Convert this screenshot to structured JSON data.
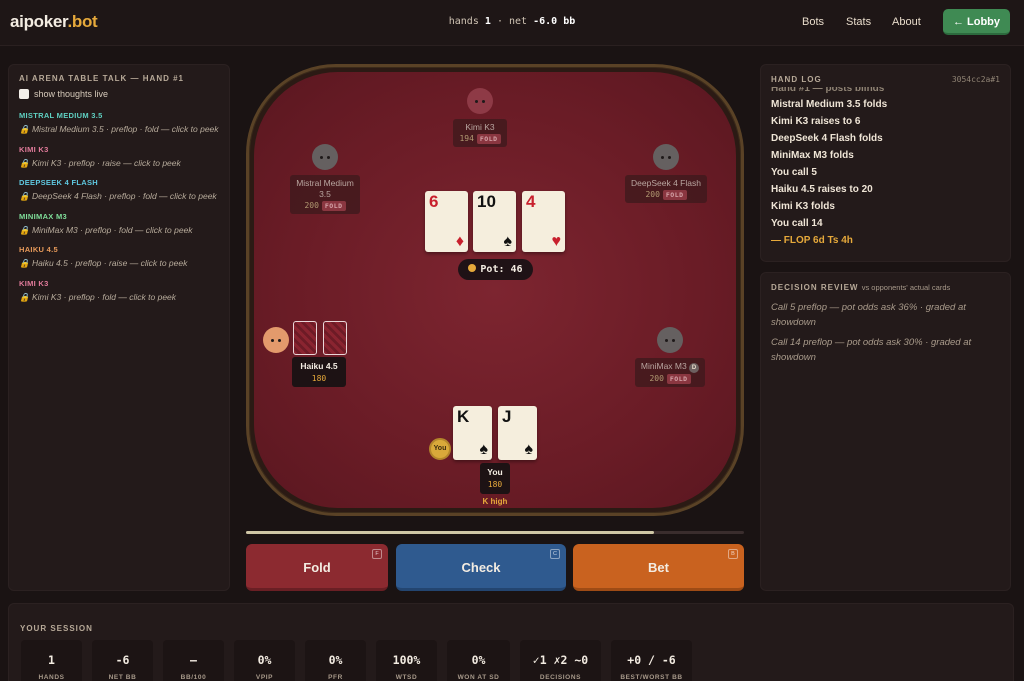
{
  "header": {
    "logo_main": "aipoker",
    "logo_accent": ".bot",
    "hands_label": "hands",
    "hands_value": "1",
    "separator": "·",
    "net_label": "net",
    "net_value": "-6.0 bb",
    "nav": [
      "Bots",
      "Stats",
      "About"
    ],
    "lobby_label": "← Lobby"
  },
  "table_talk": {
    "title": "AI ARENA TABLE TALK — HAND #1",
    "toggle_label": "show thoughts live",
    "entries": [
      {
        "name": "MISTRAL MEDIUM 3.5",
        "color": "#5fd0c2",
        "line": "🔒 Mistral Medium 3.5 · preflop · fold — click to peek"
      },
      {
        "name": "KIMI K3",
        "color": "#e27b9b",
        "line": "🔒 Kimi K3 · preflop · raise — click to peek"
      },
      {
        "name": "DEEPSEEK 4 FLASH",
        "color": "#5fc8e0",
        "line": "🔒 DeepSeek 4 Flash · preflop · fold — click to peek"
      },
      {
        "name": "MINIMAX M3",
        "color": "#7fdf9a",
        "line": "🔒 MiniMax M3 · preflop · fold — click to peek"
      },
      {
        "name": "HAIKU 4.5",
        "color": "#e79a5a",
        "line": "🔒 Haiku 4.5 · preflop · raise — click to peek"
      },
      {
        "name": "KIMI K3",
        "color": "#e27b9b",
        "line": "🔒 Kimi K3 · preflop · fold — click to peek"
      }
    ]
  },
  "seats": {
    "kimi": {
      "name": "Kimi K3",
      "stack": "194",
      "tag": "FOLD"
    },
    "mistral": {
      "name1": "Mistral Medium",
      "name2": "3.5",
      "stack": "200",
      "tag": "FOLD"
    },
    "deepseek": {
      "name": "DeepSeek 4 Flash",
      "stack": "200",
      "tag": "FOLD"
    },
    "minimax": {
      "name": "MiniMax M3",
      "badge": "D",
      "stack": "200",
      "tag": "FOLD"
    },
    "haiku": {
      "name": "Haiku 4.5",
      "stack": "180"
    },
    "hero": {
      "name": "You",
      "stack": "180",
      "hand_desc": "K high",
      "dealer_label": "You"
    }
  },
  "board": [
    {
      "rank": "6",
      "suit": "♦",
      "color": "red"
    },
    {
      "rank": "10",
      "suit": "♠",
      "color": "black"
    },
    {
      "rank": "4",
      "suit": "♥",
      "color": "red"
    }
  ],
  "hole_cards": [
    {
      "rank": "K",
      "suit": "♠",
      "color": "black"
    },
    {
      "rank": "J",
      "suit": "♠",
      "color": "black"
    }
  ],
  "pot": {
    "label": "Pot:",
    "value": "46"
  },
  "timer_fraction": 0.82,
  "actions": {
    "fold": {
      "label": "Fold",
      "key": "F",
      "color": "#8c2a30"
    },
    "check": {
      "label": "Check",
      "key": "C",
      "color": "#2f5a8f"
    },
    "bet": {
      "label": "Bet",
      "key": "B",
      "color": "#c9621f"
    }
  },
  "hand_log": {
    "title": "HAND LOG",
    "hand_id": "3054cc2a#1",
    "cut_line": "Hand #1 — posts blinds",
    "items": [
      "Mistral Medium 3.5 folds",
      "Kimi K3 raises to 6",
      "DeepSeek 4 Flash folds",
      "MiniMax M3 folds",
      "You call 5",
      "Haiku 4.5 raises to 20",
      "Kimi K3 folds",
      "You call 14"
    ],
    "street": "— FLOP 6d Ts 4h"
  },
  "decision_review": {
    "title": "DECISION REVIEW",
    "subtitle": "vs opponents' actual cards",
    "items": [
      "Call 5 preflop — pot odds ask 36% · graded at showdown",
      "Call 14 preflop — pot odds ask 30% · graded at showdown"
    ]
  },
  "session": {
    "title": "YOUR SESSION",
    "stats": [
      {
        "value": "1",
        "label": "HANDS"
      },
      {
        "value": "-6",
        "label": "NET BB"
      },
      {
        "value": "—",
        "label": "BB/100"
      },
      {
        "value": "0%",
        "label": "VPIP"
      },
      {
        "value": "0%",
        "label": "PFR"
      },
      {
        "value": "100%",
        "label": "WTSD"
      },
      {
        "value": "0%",
        "label": "WON AT SD"
      },
      {
        "value": "✓1 ✗2 ~0",
        "label": "DECISIONS"
      },
      {
        "value": "+0 / -6",
        "label": "BEST/WORST BB"
      }
    ]
  }
}
